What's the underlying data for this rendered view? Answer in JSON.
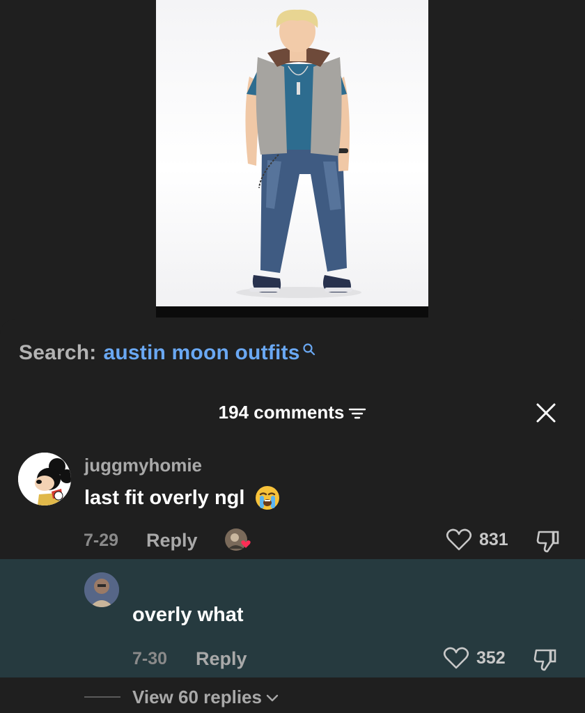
{
  "search": {
    "label": "Search:",
    "query": "austin moon outfits",
    "icon": "search-icon"
  },
  "comments": {
    "count_label": "194 comments",
    "filter_icon": "filter-icon",
    "close_icon": "close-icon"
  },
  "comment_main": {
    "username": "juggmyhomie",
    "text": "last fit overly ngl",
    "emoji": "loudly-crying-face-icon",
    "date": "7-29",
    "reply_label": "Reply",
    "likes": "831"
  },
  "comment_reply": {
    "text": "overly what",
    "date": "7-30",
    "reply_label": "Reply",
    "likes": "352"
  },
  "view_replies": {
    "label": "View 60 replies"
  },
  "colors": {
    "background": "#1f1f1f",
    "search_query": "#6aa8f3",
    "reply_highlight": "#263a3f",
    "creator_heart": "#ff2d55"
  }
}
